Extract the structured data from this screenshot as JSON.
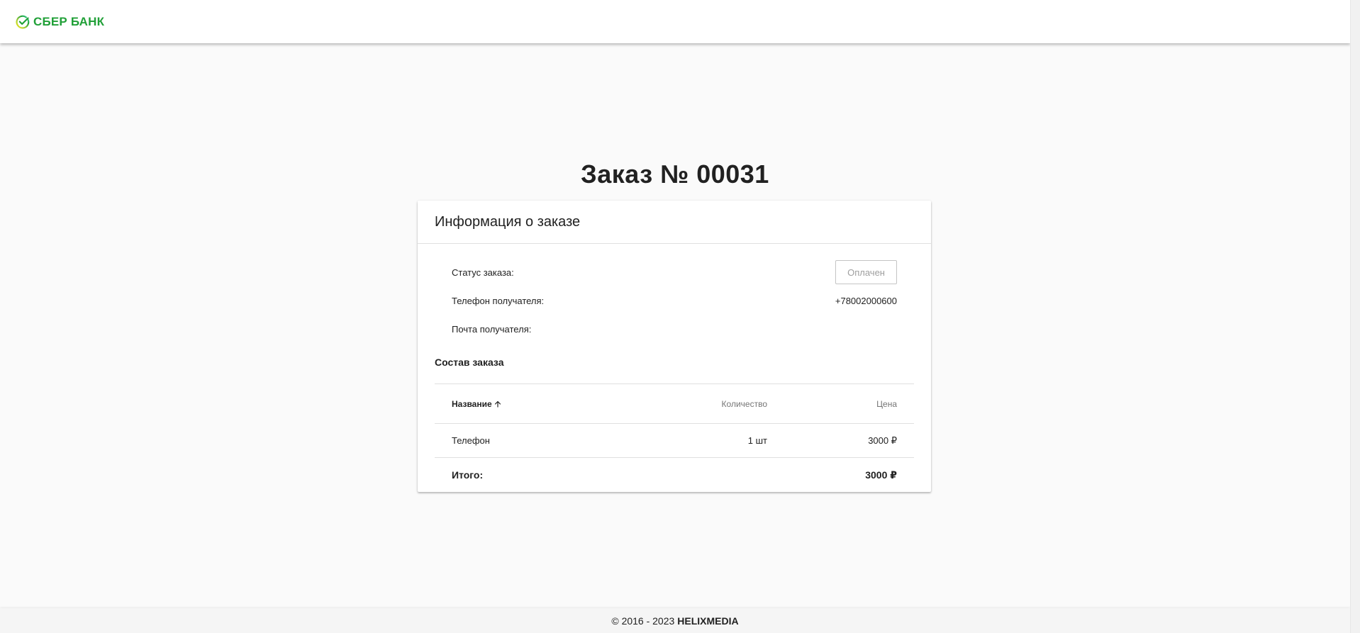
{
  "header": {
    "logo_text": "СБЕР БАНК",
    "brand_color": "#21a038"
  },
  "page": {
    "title": "Заказ № 00031"
  },
  "order_info": {
    "title": "Информация о заказе",
    "status_label": "Статус заказа:",
    "status_value": "Оплачен",
    "phone_label": "Телефон получателя:",
    "phone_value": "+78002000600",
    "email_label": "Почта получателя:",
    "email_value": ""
  },
  "order_items": {
    "title": "Состав заказа",
    "columns": {
      "name": "Название",
      "quantity": "Количество",
      "price": "Цена"
    },
    "sort_icon": "arrow-up-icon",
    "rows": [
      {
        "name": "Телефон",
        "quantity": "1 шт",
        "price": "3000 ₽"
      }
    ],
    "total_label": "Итого:",
    "total_value": "3000 ₽"
  },
  "footer": {
    "copyright": "© 2016 - 2023",
    "company": "HELIXMEDIA"
  }
}
